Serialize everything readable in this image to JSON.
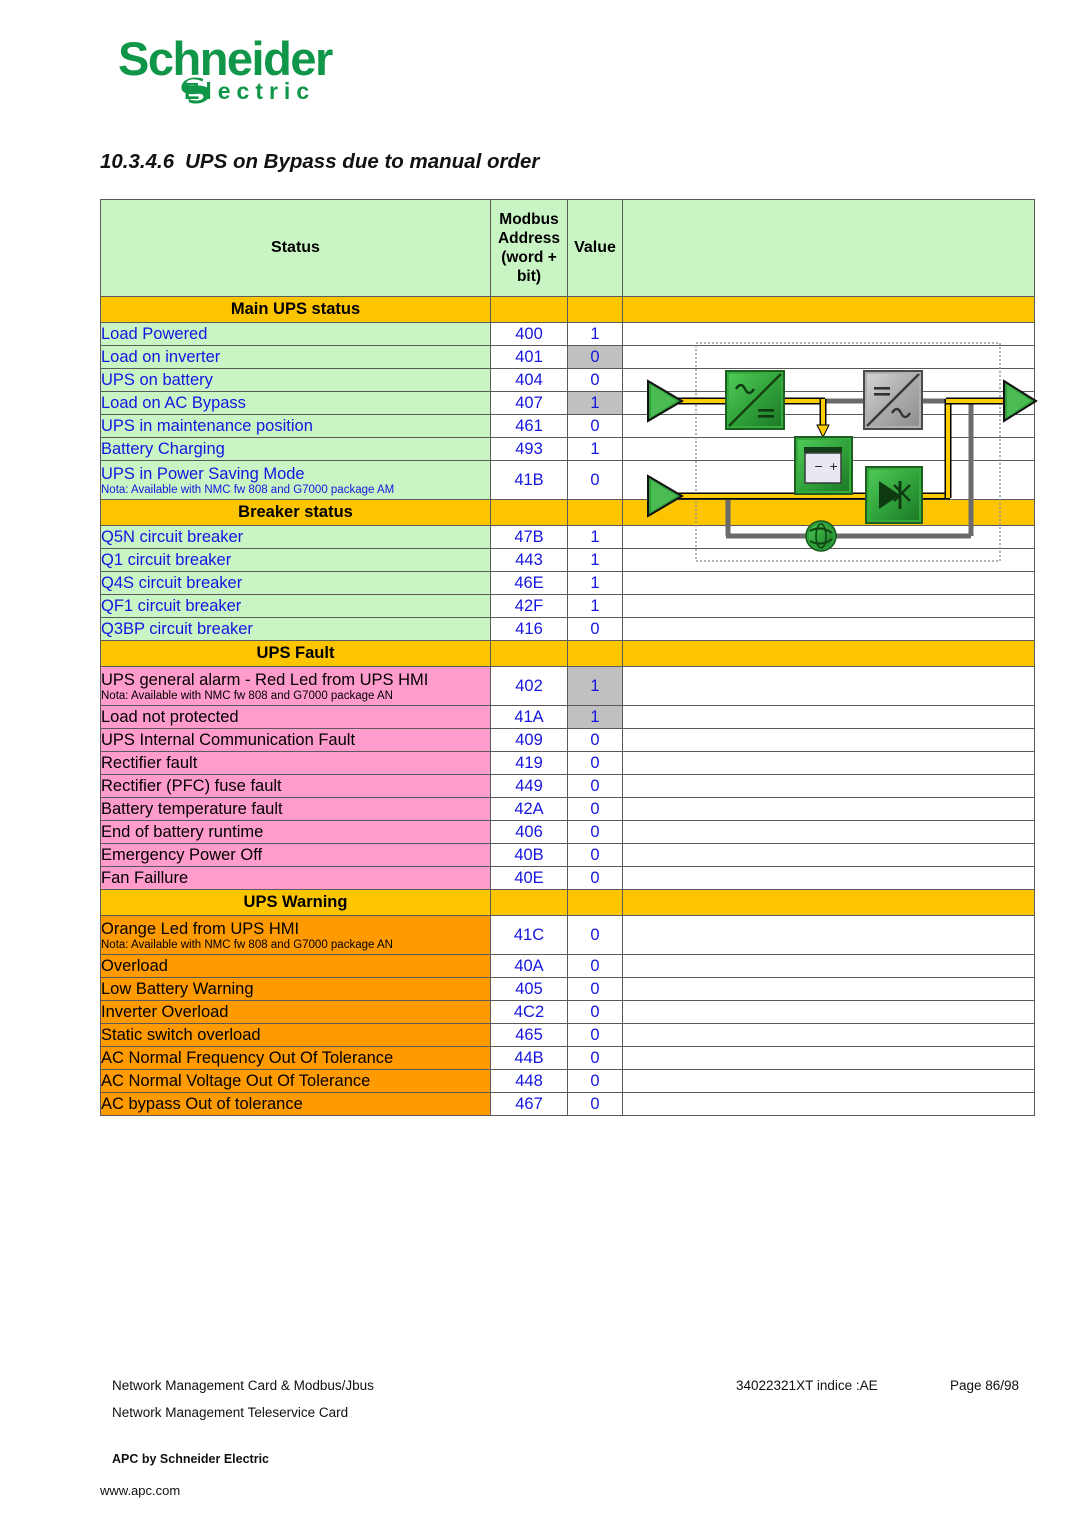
{
  "logo": {
    "brand": "Schneider",
    "sub": "Electric",
    "green": "#109648",
    "swirl_icon": "schneider-swirl-icon"
  },
  "page_title": {
    "number": "10.3.4.6",
    "text": "UPS on Bypass due to manual order"
  },
  "table": {
    "headers": {
      "status": "Status",
      "address": "Modbus Address (word + bit)",
      "address_line1": "Modbus",
      "address_line2": "Address",
      "address_line3": "(word +",
      "address_line4": "bit)",
      "value": "Value",
      "diagram": ""
    },
    "colors": {
      "header_bg": "#c9f5c5",
      "section_band_bg": "#fdc400",
      "green_row": "#c9f5c5",
      "pink_row": "#ff9ccc",
      "orange_row": "#ff9a00",
      "value_highlight": "#c0c0c0",
      "link_text": "#1515e0",
      "border": "#5a5a5a"
    },
    "sections": [
      {
        "title": "Main UPS status",
        "tint": "tint-green",
        "rows": [
          {
            "label": "Load Powered",
            "nota": "",
            "address": "400",
            "value": "1",
            "highlight": false
          },
          {
            "label": "Load on inverter",
            "nota": "",
            "address": "401",
            "value": "0",
            "highlight": true
          },
          {
            "label": "UPS on battery",
            "nota": "",
            "address": "404",
            "value": "0",
            "highlight": false
          },
          {
            "label": "Load on AC Bypass",
            "nota": "",
            "address": "407",
            "value": "1",
            "highlight": true
          },
          {
            "label": "UPS in maintenance position",
            "nota": "",
            "address": "461",
            "value": "0",
            "highlight": false
          },
          {
            "label": "Battery Charging",
            "nota": "",
            "address": "493",
            "value": "1",
            "highlight": false
          },
          {
            "label": "UPS in Power Saving Mode",
            "nota": "Nota: Available with NMC fw 808 and G7000 package AM",
            "address": "41B",
            "value": "0",
            "highlight": false
          }
        ]
      },
      {
        "title": "Breaker status",
        "tint": "tint-green",
        "rows": [
          {
            "label": "Q5N circuit breaker",
            "nota": "",
            "address": "47B",
            "value": "1",
            "highlight": false
          },
          {
            "label": "Q1 circuit breaker",
            "nota": "",
            "address": "443",
            "value": "1",
            "highlight": false
          },
          {
            "label": "Q4S circuit breaker",
            "nota": "",
            "address": "46E",
            "value": "1",
            "highlight": false
          },
          {
            "label": "QF1 circuit breaker",
            "nota": "",
            "address": "42F",
            "value": "1",
            "highlight": false
          },
          {
            "label": "Q3BP circuit breaker",
            "nota": "",
            "address": "416",
            "value": "0",
            "highlight": false
          }
        ]
      },
      {
        "title": "UPS Fault",
        "tint": "tint-pink",
        "rows": [
          {
            "label": "UPS general alarm - Red Led from UPS HMI",
            "nota": "Nota: Available with NMC fw 808 and G7000 package AN",
            "address": "402",
            "value": "1",
            "highlight": true
          },
          {
            "label": "Load not protected",
            "nota": "",
            "address": "41A",
            "value": "1",
            "highlight": true
          },
          {
            "label": "UPS Internal Communication Fault",
            "nota": "",
            "address": "409",
            "value": "0",
            "highlight": false
          },
          {
            "label": "Rectifier fault",
            "nota": "",
            "address": "419",
            "value": "0",
            "highlight": false
          },
          {
            "label": "Rectifier (PFC) fuse fault",
            "nota": "",
            "address": "449",
            "value": "0",
            "highlight": false
          },
          {
            "label": "Battery temperature fault",
            "nota": "",
            "address": "42A",
            "value": "0",
            "highlight": false
          },
          {
            "label": "End of battery runtime",
            "nota": "",
            "address": "406",
            "value": "0",
            "highlight": false
          },
          {
            "label": "Emergency Power Off",
            "nota": "",
            "address": "40B",
            "value": "0",
            "highlight": false
          },
          {
            "label": "Fan Faillure",
            "nota": "",
            "address": "40E",
            "value": "0",
            "highlight": false
          }
        ]
      },
      {
        "title": "UPS Warning",
        "tint": "tint-orange",
        "rows": [
          {
            "label": "Orange Led from UPS HMI",
            "nota": "Nota: Available with NMC fw 808 and G7000 package AN",
            "address": "41C",
            "value": "0",
            "highlight": false
          },
          {
            "label": "Overload",
            "nota": "",
            "address": "40A",
            "value": "0",
            "highlight": false
          },
          {
            "label": "Low Battery Warning",
            "nota": "",
            "address": "405",
            "value": "0",
            "highlight": false
          },
          {
            "label": "Inverter Overload",
            "nota": "",
            "address": "4C2",
            "value": "0",
            "highlight": false
          },
          {
            "label": "Static switch overload",
            "nota": "",
            "address": "465",
            "value": "0",
            "highlight": false
          },
          {
            "label": "AC Normal Frequency Out Of Tolerance",
            "nota": "",
            "address": "44B",
            "value": "0",
            "highlight": false
          },
          {
            "label": "AC Normal Voltage Out Of Tolerance",
            "nota": "",
            "address": "448",
            "value": "0",
            "highlight": false
          },
          {
            "label": "AC bypass Out of tolerance",
            "nota": "",
            "address": "467",
            "value": "0",
            "highlight": false
          }
        ]
      }
    ]
  },
  "diagram": {
    "name": "ups-single-line-diagram",
    "components": [
      {
        "name": "ac-input-arrow",
        "type": "arrow",
        "color": "#2f9e3c"
      },
      {
        "name": "rectifier-block",
        "type": "ac-dc-converter",
        "color": "#2fa83c"
      },
      {
        "name": "battery-block",
        "type": "battery",
        "color": "#2fa83c"
      },
      {
        "name": "inverter-block",
        "type": "dc-ac-converter",
        "color": "#a8a8a8"
      },
      {
        "name": "static-switch-block",
        "type": "static-switch",
        "color": "#2fa83c"
      },
      {
        "name": "bypass-input-arrow",
        "type": "arrow",
        "color": "#2f9e3c"
      },
      {
        "name": "output-arrow",
        "type": "arrow",
        "color": "#2f9e3c"
      },
      {
        "name": "manual-bypass-breaker",
        "type": "breaker-globe",
        "color": "#2fa83c"
      }
    ],
    "active_path_color": "#ffcc00",
    "inactive_path_color": "#6b6b6b"
  },
  "footer": {
    "left_line1": "Network Management Card & Modbus/Jbus",
    "left_line2": "Network Management Teleservice Card",
    "middle": "34022321XT indice :AE",
    "right": "Page 86/98",
    "company": "APC by Schneider Electric",
    "url": "www.apc.com"
  }
}
